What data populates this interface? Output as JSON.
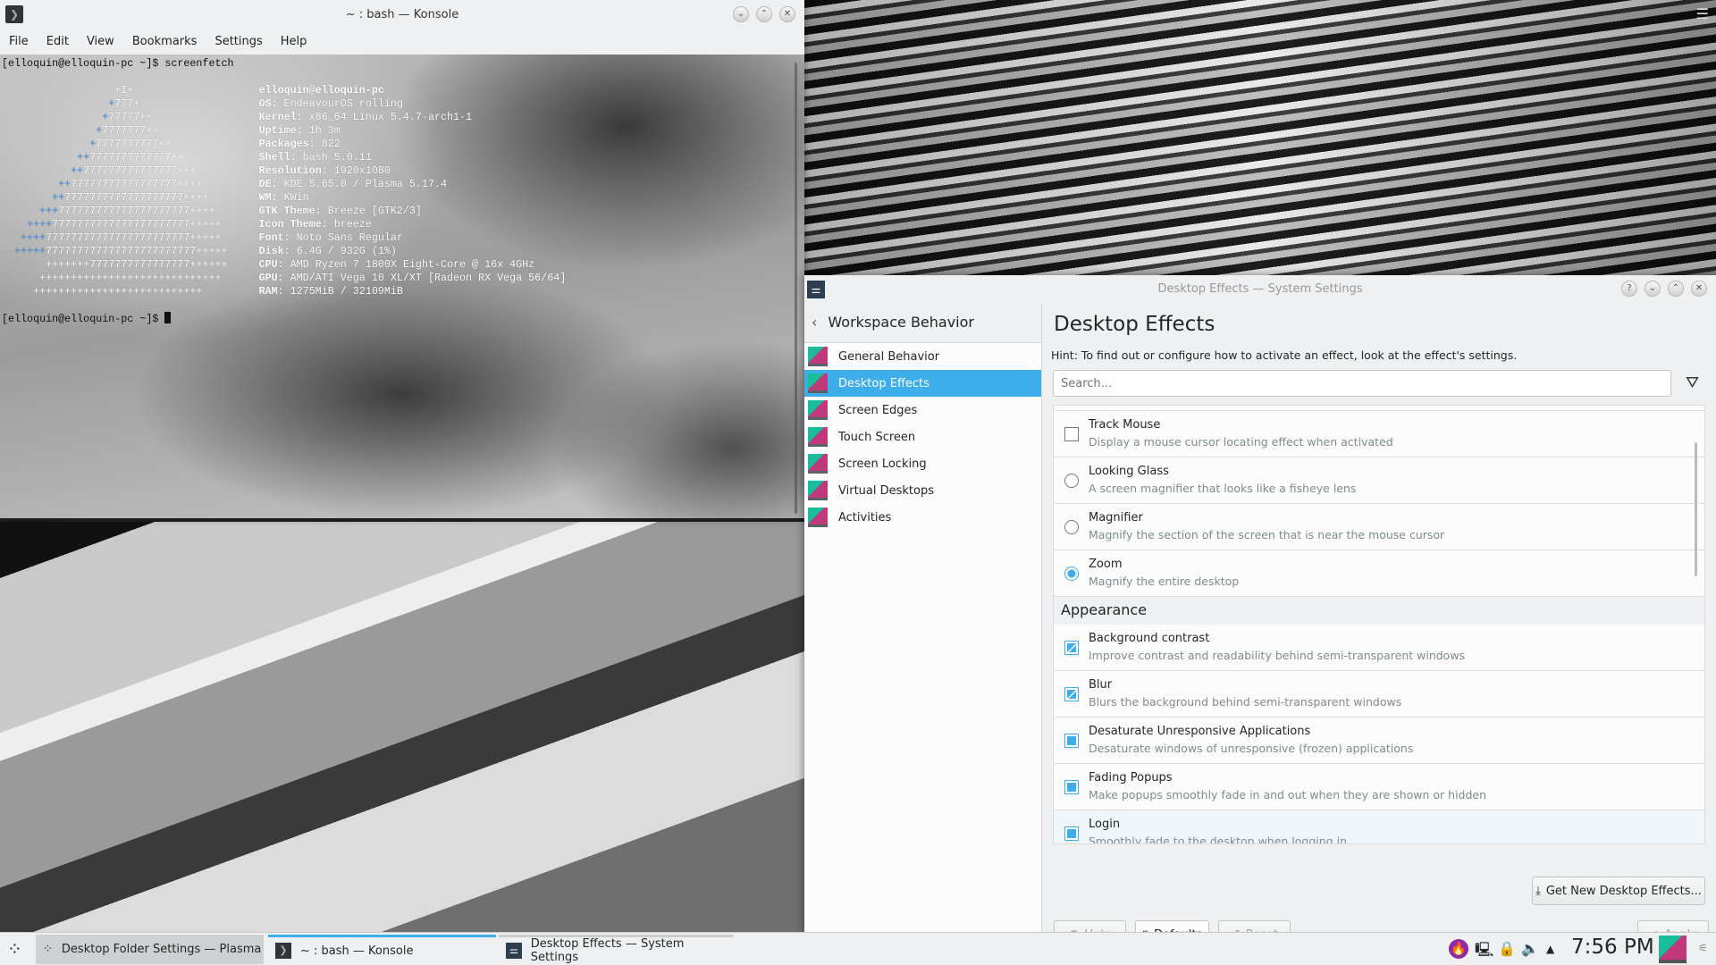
{
  "konsole": {
    "title": "~ : bash — Konsole",
    "menu": [
      "File",
      "Edit",
      "View",
      "Bookmarks",
      "Settings",
      "Help"
    ],
    "prompt": "[elloquin@elloquin-pc ~]$ ",
    "command": "screenfetch",
    "art": [
      [
        "",
        "+I+",
        18
      ],
      [
        "",
        "777+",
        17,
        "+"
      ],
      [
        "+",
        "77777++",
        16
      ],
      [
        "+",
        "7777777++",
        15
      ],
      [
        "+",
        "7777777777++",
        14
      ],
      [
        "++",
        "7777777777777++",
        12
      ],
      [
        "++",
        "777777777777777+++",
        11
      ],
      [
        "++",
        "77777777777777777++++",
        9
      ],
      [
        "++",
        "7777777777777777777++++",
        8
      ],
      [
        "+++",
        "777777777777777777777++++",
        6
      ],
      [
        "++++",
        "7777777777777777777777+++++",
        4
      ],
      [
        "++++",
        "77777777777777777777777+++++",
        3
      ],
      [
        "+++++",
        "777777777777777777777777+++++",
        2
      ],
      [
        "",
        "+++++++7777777777777777++++++",
        7
      ],
      [
        "",
        "+++++++++++++++++++++++++++++",
        6
      ],
      [
        "",
        "+++++++++++++++++++++++++++",
        5
      ]
    ],
    "info": [
      [
        "elloquin@elloquin-pc",
        ""
      ],
      [
        "OS:",
        "EndeavourOS rolling"
      ],
      [
        "Kernel:",
        "x86_64 Linux 5.4.7-arch1-1"
      ],
      [
        "Uptime:",
        "1h 3m"
      ],
      [
        "Packages:",
        "822"
      ],
      [
        "Shell:",
        "bash 5.0.11"
      ],
      [
        "Resolution:",
        "1920x1080"
      ],
      [
        "DE:",
        "KDE 5.65.0 / Plasma 5.17.4"
      ],
      [
        "WM:",
        "KWin"
      ],
      [
        "GTK Theme:",
        "Breeze [GTK2/3]"
      ],
      [
        "Icon Theme:",
        "breeze"
      ],
      [
        "Font:",
        "Noto Sans Regular"
      ],
      [
        "Disk:",
        "6.4G / 932G (1%)"
      ],
      [
        "CPU:",
        "AMD Ryzen 7 1800X Eight-Core @ 16x 4GHz"
      ],
      [
        "GPU:",
        "AMD/ATI Vega 10 XL/XT [Radeon RX Vega 56/64]"
      ],
      [
        "RAM:",
        "1275MiB / 32109MiB"
      ]
    ]
  },
  "settings": {
    "title": "Desktop Effects — System Settings",
    "sidebar": {
      "header": "Workspace Behavior",
      "items": [
        {
          "label": "General Behavior"
        },
        {
          "label": "Desktop Effects",
          "selected": true
        },
        {
          "label": "Screen Edges"
        },
        {
          "label": "Touch Screen"
        },
        {
          "label": "Screen Locking"
        },
        {
          "label": "Virtual Desktops"
        },
        {
          "label": "Activities"
        }
      ]
    },
    "page_title": "Desktop Effects",
    "hint": "Hint: To find out or configure how to activate an effect, look at the effect's settings.",
    "search_placeholder": "Search...",
    "effects": [
      {
        "type": "check",
        "state": "off",
        "name": "Track Mouse",
        "desc": "Display a mouse cursor locating effect when activated"
      },
      {
        "type": "radio",
        "state": "off",
        "name": "Looking Glass",
        "desc": "A screen magnifier that looks like a fisheye lens"
      },
      {
        "type": "radio",
        "state": "off",
        "name": "Magnifier",
        "desc": "Magnify the section of the screen that is near the mouse cursor"
      },
      {
        "type": "radio",
        "state": "on",
        "name": "Zoom",
        "desc": "Magnify the entire desktop"
      },
      {
        "section": "Appearance"
      },
      {
        "type": "check",
        "state": "part",
        "name": "Background contrast",
        "desc": "Improve contrast and readability behind semi-transparent windows"
      },
      {
        "type": "check",
        "state": "part",
        "name": "Blur",
        "desc": "Blurs the background behind semi-transparent windows"
      },
      {
        "type": "check",
        "state": "on",
        "name": "Desaturate Unresponsive Applications",
        "desc": "Desaturate windows of unresponsive (frozen) applications"
      },
      {
        "type": "check",
        "state": "on",
        "name": "Fading Popups",
        "desc": "Make popups smoothly fade in and out when they are shown or hidden"
      },
      {
        "type": "check",
        "state": "on",
        "name": "Login",
        "desc": "Smoothly fade to the desktop when logging in",
        "hover": true
      }
    ],
    "buttons": {
      "get_new": "Get New Desktop Effects...",
      "help": "Help",
      "defaults": "Defaults",
      "reset": "Reset",
      "apply": "Apply"
    }
  },
  "taskbar": {
    "tasks": [
      "Desktop Folder Settings — Plasma",
      "~ : bash — Konsole",
      "Desktop Effects — System Settings"
    ],
    "clock": "7:56 PM",
    "accent": "#3daee9"
  }
}
